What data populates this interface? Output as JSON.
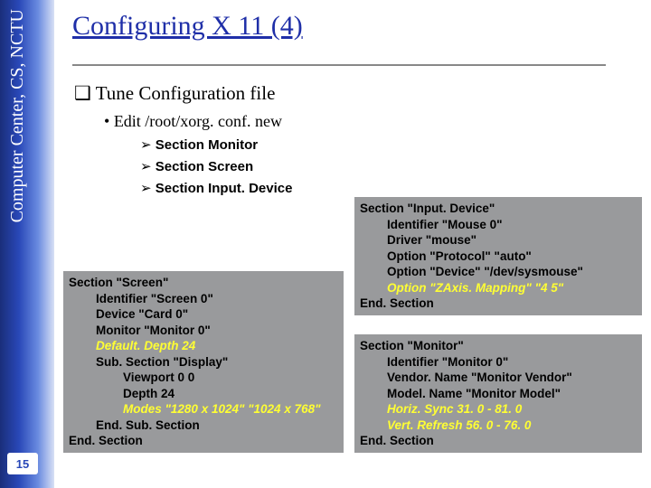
{
  "sidebar": {
    "label": "Computer Center, CS, NCTU",
    "page_number": "15"
  },
  "title": "Configuring X 11 (4)",
  "heading1": "Tune Configuration file",
  "bullet": "Edit /root/xorg. conf. new",
  "arrows": [
    "Section Monitor",
    "Section Screen",
    "Section Input. Device"
  ],
  "box_screen": {
    "l0": "Section \"Screen\"",
    "l1": "Identifier \"Screen 0\"",
    "l2": "Device \"Card 0\"",
    "l3": "Monitor \"Monitor 0\"",
    "l4": "Default. Depth 24",
    "l5": "Sub. Section \"Display\"",
    "l6": "Viewport 0 0",
    "l7": "Depth 24",
    "l8": "Modes \"1280 x 1024\" \"1024 x 768\"",
    "l9": "End. Sub. Section",
    "l10": "End. Section"
  },
  "box_input": {
    "l0": "Section \"Input. Device\"",
    "l1": "Identifier \"Mouse 0\"",
    "l2": "Driver \"mouse\"",
    "l3": "Option \"Protocol\" \"auto\"",
    "l4": "Option \"Device\" \"/dev/sysmouse\"",
    "l5": "Option \"ZAxis. Mapping\" \"4 5\"",
    "l6": "End. Section"
  },
  "box_monitor": {
    "l0": "Section \"Monitor\"",
    "l1": "Identifier \"Monitor 0\"",
    "l2": "Vendor. Name \"Monitor Vendor\"",
    "l3": "Model. Name \"Monitor Model\"",
    "l4": "Horiz. Sync 31. 0 - 81. 0",
    "l5": "Vert. Refresh 56. 0 - 76. 0",
    "l6": "End. Section"
  }
}
